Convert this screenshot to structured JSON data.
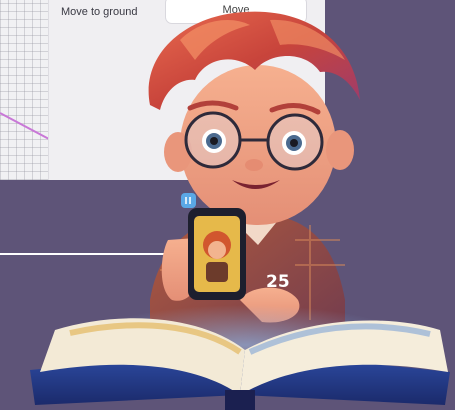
{
  "editor": {
    "move_to_ground_label": "Move to ground",
    "move_button_label": "Move"
  },
  "illustration": {
    "page_number": "25"
  },
  "colors": {
    "background": "#5e5478",
    "panel": "#f0eff2",
    "accent_pink": "#c978d7"
  },
  "icons": [
    "phone-app-icon"
  ]
}
